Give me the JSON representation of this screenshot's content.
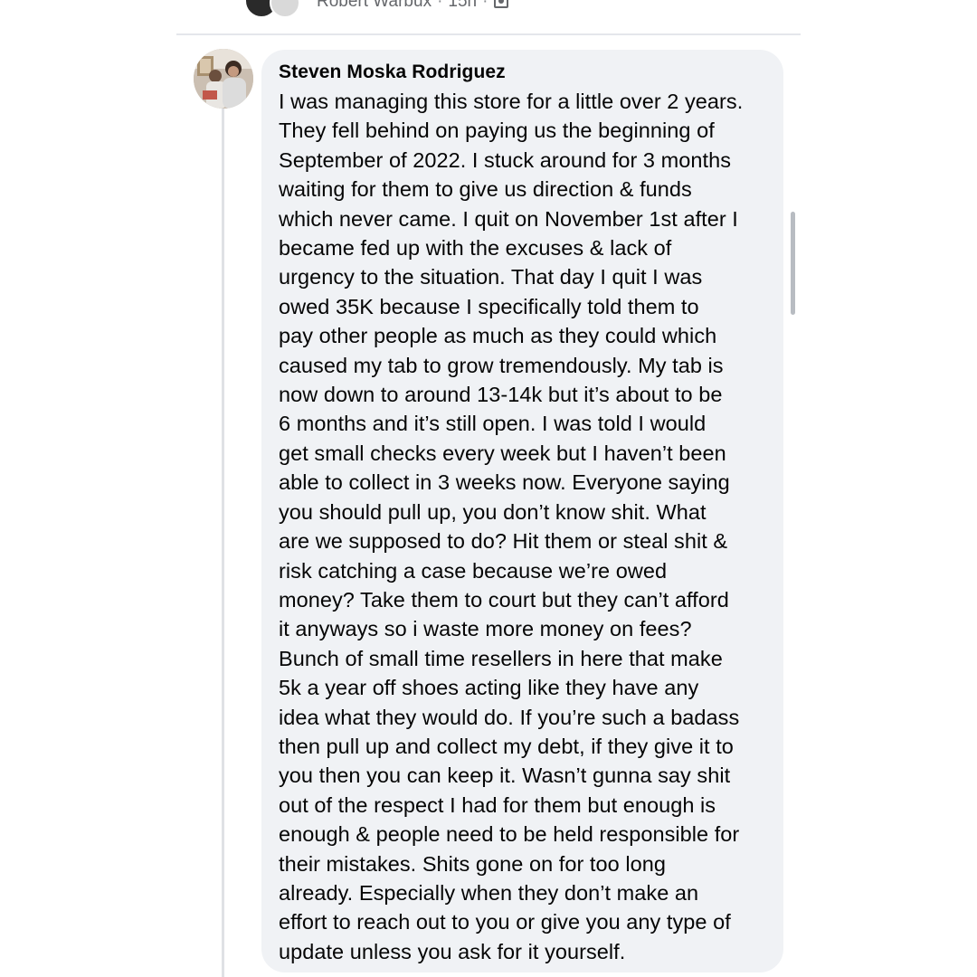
{
  "previous_comment": {
    "author": "Robert Warbux",
    "time": "15h",
    "separator": "·"
  },
  "comment": {
    "author": "Steven Moska Rodriguez",
    "text": "I was managing this store for a little over 2 years.\nThey fell behind on paying us the beginning of\nSeptember of 2022. I stuck around for 3 months\nwaiting for them to give us direction & funds\nwhich never came. I quit on November 1st after I\nbecame fed up with the excuses & lack of\nurgency to the situation. That day I quit I was\nowed 35K because I specifically told them to\npay other people as much as they could which\ncaused my tab to grow tremendously. My tab is\nnow down to around 13-14k but it’s about to be\n6 months and it’s still open. I was told I would\nget small checks every week but I haven’t been\nable to collect in 3 weeks now. Everyone saying\nyou should pull up, you don’t know shit. What\nare we supposed to do? Hit them or steal shit &\nrisk catching a case because we’re owed\nmoney? Take them to court but they can’t afford\nit anyways so i waste more money on fees?\nBunch of small time resellers in here that make\n5k a year off shoes acting like they have any\nidea what they would do. If you’re such a badass\nthen pull up and collect my debt, if they give it to\nyou then you can keep it. Wasn’t gunna say shit\nout of the respect I had for them but enough is\nenough & people need to be held responsible for\ntheir mistakes. Shits gone on for too long\nalready. Especially when they don’t make an\neffort to reach out to you or give you any type of\nupdate unless you ask for it yourself."
  },
  "icons": {
    "audience": "people-icon",
    "avatar": "profile-photo"
  },
  "colors": {
    "bubble": "#f0f2f5",
    "text": "#050505",
    "meta": "#65676b",
    "divider": "#e4e6eb"
  }
}
